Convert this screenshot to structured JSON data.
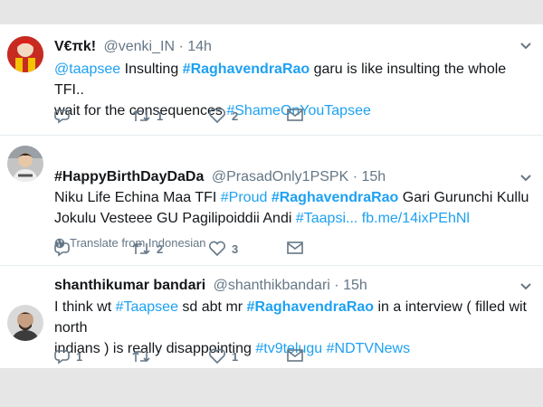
{
  "tweets": [
    {
      "name": "V€πk!",
      "handle": "@venki_IN",
      "dot": "·",
      "time": "14h",
      "lines": [
        [
          {
            "t": "@taapsee",
            "c": "hl"
          },
          {
            "t": " Insulting "
          },
          {
            "t": "#RaghavendraRao",
            "c": "hl b"
          },
          {
            "t": " garu is like insulting the whole TFI.."
          }
        ],
        [
          {
            "t": "wait for the consequences "
          },
          {
            "t": "#ShameOnYouTapsee",
            "c": "hl"
          }
        ]
      ],
      "replies": "",
      "retweets": "1",
      "likes": "2"
    },
    {
      "name": "#HappyBirthDayDaDa",
      "handle": "@PrasadOnly1PSPK",
      "dot": "·",
      "time": "15h",
      "lines": [
        [
          {
            "t": "Niku Life Echina Maa TFI "
          },
          {
            "t": "#Proud",
            "c": "hl"
          },
          {
            "t": " "
          },
          {
            "t": "#RaghavendraRao",
            "c": "hl b"
          },
          {
            "t": " Gari Gurunchi Kullu"
          }
        ],
        [
          {
            "t": "Jokulu Vesteee GU Pagilipoiddii Andi "
          },
          {
            "t": "#Taapsi...",
            "c": "hl"
          },
          {
            "t": " "
          },
          {
            "t": "fb.me/14ixPEhNl",
            "c": "hl"
          }
        ]
      ],
      "translate": "Translate from Indonesian",
      "replies": "",
      "retweets": "2",
      "likes": "3"
    },
    {
      "name": "shanthikumar bandari",
      "handle": "@shanthikbandari",
      "dot": "·",
      "time": "15h",
      "lines": [
        [
          {
            "t": "I think wt "
          },
          {
            "t": "#Taapsee",
            "c": "hl"
          },
          {
            "t": "  sd abt mr "
          },
          {
            "t": "#RaghavendraRao",
            "c": "hl b"
          },
          {
            "t": " in a interview ( filled wit north"
          }
        ],
        [
          {
            "t": "indians ) is really disappointing "
          },
          {
            "t": "#tv9telugu",
            "c": "hl"
          },
          {
            "t": " "
          },
          {
            "t": "#NDTVNews",
            "c": "hl"
          }
        ]
      ],
      "replies": "1",
      "retweets": "",
      "likes": "1"
    }
  ],
  "icons": {
    "more": "chevron-down-icon",
    "reply": "reply-icon",
    "retweet": "retweet-icon",
    "like": "heart-icon",
    "dm": "envelope-icon",
    "translate": "globe-icon"
  },
  "colors": {
    "link": "#1da1f2",
    "text": "#14171a",
    "muted": "#657786"
  }
}
